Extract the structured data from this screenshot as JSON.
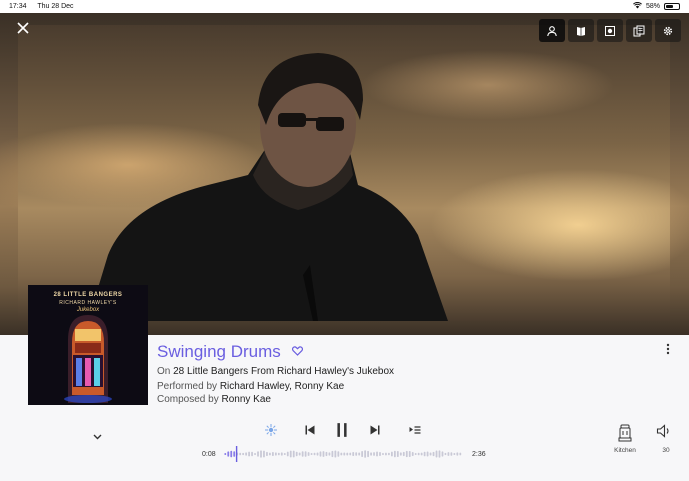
{
  "status_bar": {
    "time": "17:34",
    "date": "Thu 28 Dec",
    "battery": "58%",
    "battery_level": 0.58
  },
  "hero": {
    "tools": [
      {
        "icon": "person-icon",
        "name": "artist-tool"
      },
      {
        "icon": "book-icon",
        "name": "info-tool"
      },
      {
        "icon": "disc-icon",
        "name": "album-tool"
      },
      {
        "icon": "credits-icon",
        "name": "lyrics-tool"
      },
      {
        "icon": "gear-icon",
        "name": "settings-tool"
      }
    ]
  },
  "album_art": {
    "line1": "28 LITTLE BANGERS",
    "line2": "RICHARD HAWLEY'S",
    "line3": "Jukebox"
  },
  "track": {
    "title": "Swinging Drums",
    "on_prefix": "On",
    "album": "28 Little Bangers From Richard Hawley's Jukebox",
    "performed_prefix": "Performed by",
    "performers": "Richard Hawley, Ronny Kae",
    "composed_prefix": "Composed by",
    "composers": "Ronny Kae"
  },
  "playback": {
    "elapsed": "0:08",
    "duration": "2:36",
    "progress": 0.051,
    "state": "playing"
  },
  "output": {
    "room": "Kitchen",
    "volume": "30"
  },
  "colors": {
    "accent": "#6a5ee0",
    "waveform_played": "#8a7ee8",
    "waveform_rest": "#c9c9d6"
  }
}
